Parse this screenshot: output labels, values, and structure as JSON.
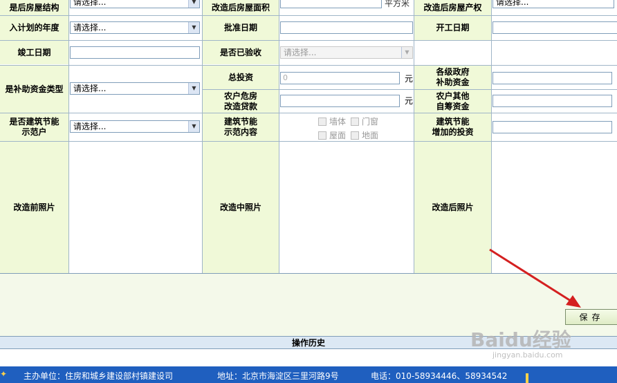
{
  "rows": {
    "row1": {
      "label_structure": "是后房屋结构",
      "select_structure": "请选择...",
      "label_area": "改造后房屋面积",
      "unit_area": "平方米",
      "label_ownership": "改造后房屋产权",
      "select_ownership": "请选择..."
    },
    "row2": {
      "label_plan_year": "入计划的年度",
      "select_plan_year": "请选择...",
      "label_approve_date": "批准日期",
      "label_start_date": "开工日期"
    },
    "row3": {
      "label_finish_date": "竣工日期",
      "label_accepted": "是否已验收",
      "select_accepted": "请选择..."
    },
    "row4": {
      "label_subsidy_type": "是补助资金类型",
      "select_subsidy_type": "请选择...",
      "label_total_invest": "总投资",
      "total_invest_value": "0",
      "unit_total_invest": "元",
      "label_gov_subsidy": "各级政府\n补助资金",
      "label_loan": "农户危房\n改造贷款",
      "unit_loan": "元",
      "label_self_fund": "农户其他\n自筹资金"
    },
    "row5": {
      "label_demo": "是否建筑节能\n示范户",
      "select_demo": "请选择...",
      "label_demo_content": "建筑节能\n示范内容",
      "checkboxes": [
        "墙体",
        "门窗",
        "屋面",
        "地面"
      ],
      "label_extra_invest": "建筑节能\n增加的投资"
    },
    "photos": {
      "before": "改造前照片",
      "during": "改造中照片",
      "after": "改造后照片"
    }
  },
  "save_button": "保存",
  "history_title": "操作历史",
  "footer": {
    "sponsor": "主办单位：住房和城乡建设部村镇建设司",
    "address": "地址：北京市海淀区三里河路9号",
    "phone": "电话：010-58934446、58934542"
  },
  "watermark": {
    "brand": "Baidu经验",
    "url": "jingyan.baidu.com"
  },
  "colors": {
    "label_bg": "#f0f9d8",
    "footer_bg": "#1f5fbf",
    "arrow": "#d42020"
  }
}
